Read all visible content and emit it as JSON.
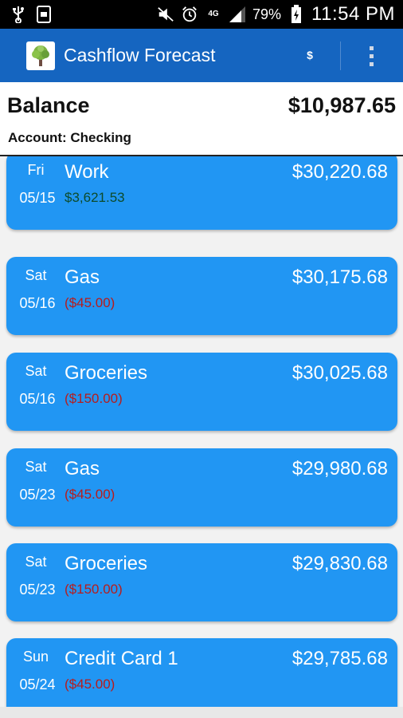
{
  "status_bar": {
    "battery_percent": "79%",
    "time": "11:54 PM",
    "network": "4G",
    "icons": [
      "usb-icon",
      "screenshot-icon",
      "mute-icon",
      "alarm-icon",
      "signal-icon",
      "battery-icon"
    ]
  },
  "app_bar": {
    "title": "Cashflow Forecast",
    "currency_symbol": "$",
    "accent_color": "#1565c0"
  },
  "balance": {
    "label": "Balance",
    "amount": "$10,987.65",
    "account": "Account: Checking"
  },
  "transactions": [
    {
      "day": "Fri",
      "date": "05/15",
      "name": "Work",
      "amount": "$3,621.53",
      "type": "income",
      "running_balance": "$30,220.68"
    },
    {
      "day": "Sat",
      "date": "05/16",
      "name": "Gas",
      "amount": "($45.00)",
      "type": "expense",
      "running_balance": "$30,175.68"
    },
    {
      "day": "Sat",
      "date": "05/16",
      "name": "Groceries",
      "amount": "($150.00)",
      "type": "expense",
      "running_balance": "$30,025.68"
    },
    {
      "day": "Sat",
      "date": "05/23",
      "name": "Gas",
      "amount": "($45.00)",
      "type": "expense",
      "running_balance": "$29,980.68"
    },
    {
      "day": "Sat",
      "date": "05/23",
      "name": "Groceries",
      "amount": "($150.00)",
      "type": "expense",
      "running_balance": "$29,830.68"
    },
    {
      "day": "Sun",
      "date": "05/24",
      "name": "Credit Card 1",
      "amount": "($45.00)",
      "type": "expense",
      "running_balance": "$29,785.68"
    }
  ],
  "colors": {
    "card": "#2196f3",
    "income_text": "#0d4b2a",
    "expense_text": "#b71c1c"
  }
}
